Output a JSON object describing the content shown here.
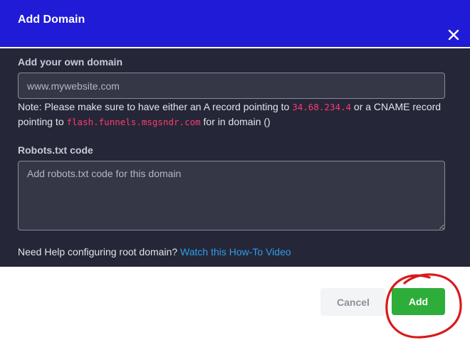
{
  "dialog": {
    "title": "Add Domain",
    "close_icon": "close-icon",
    "header_color": "#1f1bd6"
  },
  "domain": {
    "label": "Add your own domain",
    "placeholder": "www.mywebsite.com",
    "value": ""
  },
  "note": {
    "prefix": "Note: Please make sure to have either an A record pointing to ",
    "ip": "34.68.234.4",
    "middle": " or a CNAME record pointing to ",
    "cname": "flash.funnels.msgsndr.com",
    "suffix": " for in domain ()"
  },
  "robots": {
    "label": "Robots.txt code",
    "placeholder": "Add robots.txt code for this domain",
    "value": ""
  },
  "help": {
    "text": "Need Help configuring root domain? ",
    "link": "Watch this How-To Video"
  },
  "footer": {
    "cancel_label": "Cancel",
    "add_label": "Add"
  },
  "colors": {
    "body_bg": "#252638",
    "code_color": "#ff3b6e",
    "link_color": "#2f9fe3",
    "add_button": "#2fad3b",
    "annotation_circle": "#d91a1a"
  }
}
